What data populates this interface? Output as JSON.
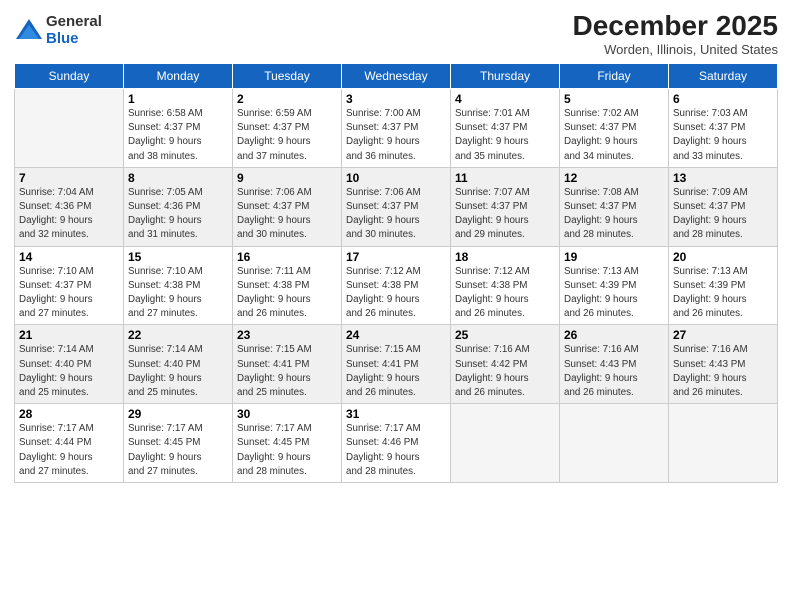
{
  "logo": {
    "general": "General",
    "blue": "Blue"
  },
  "header": {
    "month": "December 2025",
    "location": "Worden, Illinois, United States"
  },
  "days_of_week": [
    "Sunday",
    "Monday",
    "Tuesday",
    "Wednesday",
    "Thursday",
    "Friday",
    "Saturday"
  ],
  "weeks": [
    [
      {
        "day": "",
        "info": ""
      },
      {
        "day": "1",
        "info": "Sunrise: 6:58 AM\nSunset: 4:37 PM\nDaylight: 9 hours\nand 38 minutes."
      },
      {
        "day": "2",
        "info": "Sunrise: 6:59 AM\nSunset: 4:37 PM\nDaylight: 9 hours\nand 37 minutes."
      },
      {
        "day": "3",
        "info": "Sunrise: 7:00 AM\nSunset: 4:37 PM\nDaylight: 9 hours\nand 36 minutes."
      },
      {
        "day": "4",
        "info": "Sunrise: 7:01 AM\nSunset: 4:37 PM\nDaylight: 9 hours\nand 35 minutes."
      },
      {
        "day": "5",
        "info": "Sunrise: 7:02 AM\nSunset: 4:37 PM\nDaylight: 9 hours\nand 34 minutes."
      },
      {
        "day": "6",
        "info": "Sunrise: 7:03 AM\nSunset: 4:37 PM\nDaylight: 9 hours\nand 33 minutes."
      }
    ],
    [
      {
        "day": "7",
        "info": "Sunrise: 7:04 AM\nSunset: 4:36 PM\nDaylight: 9 hours\nand 32 minutes."
      },
      {
        "day": "8",
        "info": "Sunrise: 7:05 AM\nSunset: 4:36 PM\nDaylight: 9 hours\nand 31 minutes."
      },
      {
        "day": "9",
        "info": "Sunrise: 7:06 AM\nSunset: 4:37 PM\nDaylight: 9 hours\nand 30 minutes."
      },
      {
        "day": "10",
        "info": "Sunrise: 7:06 AM\nSunset: 4:37 PM\nDaylight: 9 hours\nand 30 minutes."
      },
      {
        "day": "11",
        "info": "Sunrise: 7:07 AM\nSunset: 4:37 PM\nDaylight: 9 hours\nand 29 minutes."
      },
      {
        "day": "12",
        "info": "Sunrise: 7:08 AM\nSunset: 4:37 PM\nDaylight: 9 hours\nand 28 minutes."
      },
      {
        "day": "13",
        "info": "Sunrise: 7:09 AM\nSunset: 4:37 PM\nDaylight: 9 hours\nand 28 minutes."
      }
    ],
    [
      {
        "day": "14",
        "info": "Sunrise: 7:10 AM\nSunset: 4:37 PM\nDaylight: 9 hours\nand 27 minutes."
      },
      {
        "day": "15",
        "info": "Sunrise: 7:10 AM\nSunset: 4:38 PM\nDaylight: 9 hours\nand 27 minutes."
      },
      {
        "day": "16",
        "info": "Sunrise: 7:11 AM\nSunset: 4:38 PM\nDaylight: 9 hours\nand 26 minutes."
      },
      {
        "day": "17",
        "info": "Sunrise: 7:12 AM\nSunset: 4:38 PM\nDaylight: 9 hours\nand 26 minutes."
      },
      {
        "day": "18",
        "info": "Sunrise: 7:12 AM\nSunset: 4:38 PM\nDaylight: 9 hours\nand 26 minutes."
      },
      {
        "day": "19",
        "info": "Sunrise: 7:13 AM\nSunset: 4:39 PM\nDaylight: 9 hours\nand 26 minutes."
      },
      {
        "day": "20",
        "info": "Sunrise: 7:13 AM\nSunset: 4:39 PM\nDaylight: 9 hours\nand 26 minutes."
      }
    ],
    [
      {
        "day": "21",
        "info": "Sunrise: 7:14 AM\nSunset: 4:40 PM\nDaylight: 9 hours\nand 25 minutes."
      },
      {
        "day": "22",
        "info": "Sunrise: 7:14 AM\nSunset: 4:40 PM\nDaylight: 9 hours\nand 25 minutes."
      },
      {
        "day": "23",
        "info": "Sunrise: 7:15 AM\nSunset: 4:41 PM\nDaylight: 9 hours\nand 25 minutes."
      },
      {
        "day": "24",
        "info": "Sunrise: 7:15 AM\nSunset: 4:41 PM\nDaylight: 9 hours\nand 26 minutes."
      },
      {
        "day": "25",
        "info": "Sunrise: 7:16 AM\nSunset: 4:42 PM\nDaylight: 9 hours\nand 26 minutes."
      },
      {
        "day": "26",
        "info": "Sunrise: 7:16 AM\nSunset: 4:43 PM\nDaylight: 9 hours\nand 26 minutes."
      },
      {
        "day": "27",
        "info": "Sunrise: 7:16 AM\nSunset: 4:43 PM\nDaylight: 9 hours\nand 26 minutes."
      }
    ],
    [
      {
        "day": "28",
        "info": "Sunrise: 7:17 AM\nSunset: 4:44 PM\nDaylight: 9 hours\nand 27 minutes."
      },
      {
        "day": "29",
        "info": "Sunrise: 7:17 AM\nSunset: 4:45 PM\nDaylight: 9 hours\nand 27 minutes."
      },
      {
        "day": "30",
        "info": "Sunrise: 7:17 AM\nSunset: 4:45 PM\nDaylight: 9 hours\nand 28 minutes."
      },
      {
        "day": "31",
        "info": "Sunrise: 7:17 AM\nSunset: 4:46 PM\nDaylight: 9 hours\nand 28 minutes."
      },
      {
        "day": "",
        "info": ""
      },
      {
        "day": "",
        "info": ""
      },
      {
        "day": "",
        "info": ""
      }
    ]
  ]
}
